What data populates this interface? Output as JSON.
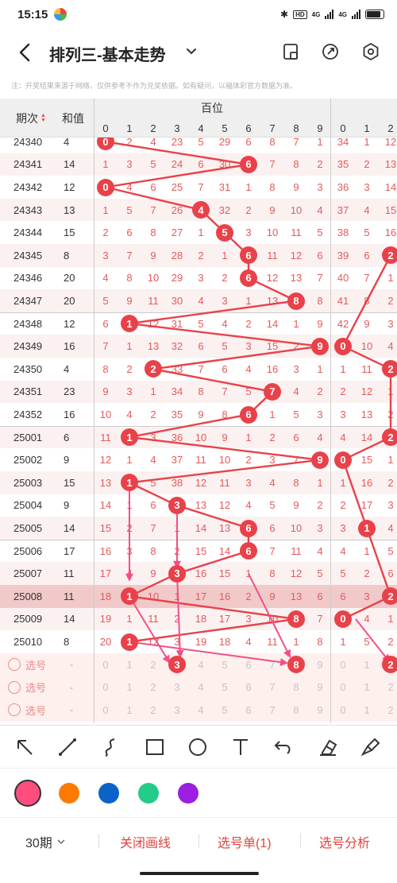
{
  "status_bar": {
    "time": "15:15",
    "net1": "4G",
    "net2": "4G",
    "hd": "HD"
  },
  "header": {
    "title": "排列三-基本走势"
  },
  "notice": "注：开奖结果来源于网络、仅供参考不作为兑奖依据。如有疑问，以福体彩官方数据为准。",
  "table": {
    "col_issue": "期次",
    "col_sum": "和值",
    "group1": "百位",
    "digits": [
      "0",
      "1",
      "2",
      "3",
      "4",
      "5",
      "6",
      "7",
      "8",
      "9"
    ],
    "digits2": [
      "0",
      "1",
      "2"
    ],
    "rows": [
      {
        "issue": "24340",
        "sum": "4",
        "c": [
          "0",
          "2",
          "4",
          "23",
          "5",
          "29",
          "6",
          "8",
          "7",
          "1"
        ],
        "g": [
          "34",
          "1",
          "12"
        ]
      },
      {
        "issue": "24341",
        "sum": "14",
        "c": [
          "1",
          "3",
          "5",
          "24",
          "6",
          "30",
          "6",
          "7",
          "8",
          "2"
        ],
        "g": [
          "35",
          "2",
          "13"
        ]
      },
      {
        "issue": "24342",
        "sum": "12",
        "c": [
          "0",
          "4",
          "6",
          "25",
          "7",
          "31",
          "1",
          "8",
          "9",
          "3"
        ],
        "g": [
          "36",
          "3",
          "14"
        ]
      },
      {
        "issue": "24343",
        "sum": "13",
        "c": [
          "1",
          "5",
          "7",
          "26",
          "4",
          "32",
          "2",
          "9",
          "10",
          "4"
        ],
        "g": [
          "37",
          "4",
          "15"
        ]
      },
      {
        "issue": "24344",
        "sum": "15",
        "c": [
          "2",
          "6",
          "8",
          "27",
          "1",
          "5",
          "3",
          "10",
          "11",
          "5"
        ],
        "g": [
          "38",
          "5",
          "16"
        ]
      },
      {
        "issue": "24345",
        "sum": "8",
        "c": [
          "3",
          "7",
          "9",
          "28",
          "2",
          "1",
          "6",
          "11",
          "12",
          "6"
        ],
        "g": [
          "39",
          "6",
          "2"
        ]
      },
      {
        "issue": "24346",
        "sum": "20",
        "c": [
          "4",
          "8",
          "10",
          "29",
          "3",
          "2",
          "6",
          "12",
          "13",
          "7"
        ],
        "g": [
          "40",
          "7",
          "1"
        ]
      },
      {
        "issue": "24347",
        "sum": "20",
        "c": [
          "5",
          "9",
          "11",
          "30",
          "4",
          "3",
          "1",
          "13",
          "8",
          "8"
        ],
        "g": [
          "41",
          "8",
          "2"
        ]
      },
      {
        "issue": "24348",
        "sum": "12",
        "c": [
          "6",
          "1",
          "12",
          "31",
          "5",
          "4",
          "2",
          "14",
          "1",
          "9"
        ],
        "g": [
          "42",
          "9",
          "3"
        ]
      },
      {
        "issue": "24349",
        "sum": "16",
        "c": [
          "7",
          "1",
          "13",
          "32",
          "6",
          "5",
          "3",
          "15",
          "2",
          "9"
        ],
        "g": [
          "0",
          "10",
          "4"
        ]
      },
      {
        "issue": "24350",
        "sum": "4",
        "c": [
          "8",
          "2",
          "2",
          "33",
          "7",
          "6",
          "4",
          "16",
          "3",
          "1"
        ],
        "g": [
          "1",
          "11",
          "2"
        ]
      },
      {
        "issue": "24351",
        "sum": "23",
        "c": [
          "9",
          "3",
          "1",
          "34",
          "8",
          "7",
          "5",
          "7",
          "4",
          "2"
        ],
        "g": [
          "2",
          "12",
          "1"
        ]
      },
      {
        "issue": "24352",
        "sum": "16",
        "c": [
          "10",
          "4",
          "2",
          "35",
          "9",
          "8",
          "6",
          "1",
          "5",
          "3"
        ],
        "g": [
          "3",
          "13",
          "2"
        ]
      },
      {
        "issue": "25001",
        "sum": "6",
        "c": [
          "11",
          "1",
          "3",
          "36",
          "10",
          "9",
          "1",
          "2",
          "6",
          "4"
        ],
        "g": [
          "4",
          "14",
          "2"
        ]
      },
      {
        "issue": "25002",
        "sum": "9",
        "c": [
          "12",
          "1",
          "4",
          "37",
          "11",
          "10",
          "2",
          "3",
          "7",
          "9"
        ],
        "g": [
          "0",
          "15",
          "1"
        ]
      },
      {
        "issue": "25003",
        "sum": "15",
        "c": [
          "13",
          "1",
          "5",
          "38",
          "12",
          "11",
          "3",
          "4",
          "8",
          "1"
        ],
        "g": [
          "1",
          "16",
          "2"
        ]
      },
      {
        "issue": "25004",
        "sum": "9",
        "c": [
          "14",
          "1",
          "6",
          "3",
          "13",
          "12",
          "4",
          "5",
          "9",
          "2"
        ],
        "g": [
          "2",
          "17",
          "3"
        ]
      },
      {
        "issue": "25005",
        "sum": "14",
        "c": [
          "15",
          "2",
          "7",
          "1",
          "14",
          "13",
          "6",
          "6",
          "10",
          "3"
        ],
        "g": [
          "3",
          "1",
          "4"
        ]
      },
      {
        "issue": "25006",
        "sum": "17",
        "c": [
          "16",
          "3",
          "8",
          "2",
          "15",
          "14",
          "6",
          "7",
          "11",
          "4"
        ],
        "g": [
          "4",
          "1",
          "5"
        ]
      },
      {
        "issue": "25007",
        "sum": "11",
        "c": [
          "17",
          "4",
          "9",
          "3",
          "16",
          "15",
          "1",
          "8",
          "12",
          "5"
        ],
        "g": [
          "5",
          "2",
          "6"
        ]
      },
      {
        "issue": "25008",
        "sum": "11",
        "c": [
          "18",
          "1",
          "10",
          "1",
          "17",
          "16",
          "2",
          "9",
          "13",
          "6"
        ],
        "g": [
          "6",
          "3",
          "2"
        ]
      },
      {
        "issue": "25009",
        "sum": "14",
        "c": [
          "19",
          "1",
          "11",
          "2",
          "18",
          "17",
          "3",
          "10",
          "8",
          "7"
        ],
        "g": [
          "0",
          "4",
          "1"
        ]
      },
      {
        "issue": "25010",
        "sum": "8",
        "c": [
          "20",
          "1",
          "12",
          "3",
          "19",
          "18",
          "4",
          "11",
          "1",
          "8"
        ],
        "g": [
          "1",
          "5",
          "2"
        ]
      }
    ],
    "pick_rows": [
      {
        "label": "选号",
        "sum": "-",
        "c": [
          "0",
          "1",
          "2",
          "3",
          "4",
          "5",
          "6",
          "7",
          "8",
          "9"
        ],
        "g": [
          "0",
          "1",
          "2"
        ]
      },
      {
        "label": "选号",
        "sum": "-",
        "c": [
          "0",
          "1",
          "2",
          "3",
          "4",
          "5",
          "6",
          "7",
          "8",
          "9"
        ],
        "g": [
          "0",
          "1",
          "2"
        ]
      },
      {
        "label": "选号",
        "sum": "-",
        "c": [
          "0",
          "1",
          "2",
          "3",
          "4",
          "5",
          "6",
          "7",
          "8",
          "9"
        ],
        "g": [
          "0",
          "1",
          "2"
        ]
      }
    ]
  },
  "draw_tools": [
    "arrow-tool",
    "line-tool",
    "curve-tool",
    "rect-tool",
    "circle-tool",
    "text-tool",
    "undo-tool",
    "eraser-tool",
    "clear-tool"
  ],
  "colors": [
    "#ff4d7e",
    "#ff7a00",
    "#0a64c8",
    "#22cc88",
    "#9a1fe0"
  ],
  "bottom_bar": {
    "period": "30期",
    "close_draw": "关闭画线",
    "pick_list": "选号单(1)",
    "pick_analysis": "选号分析"
  }
}
